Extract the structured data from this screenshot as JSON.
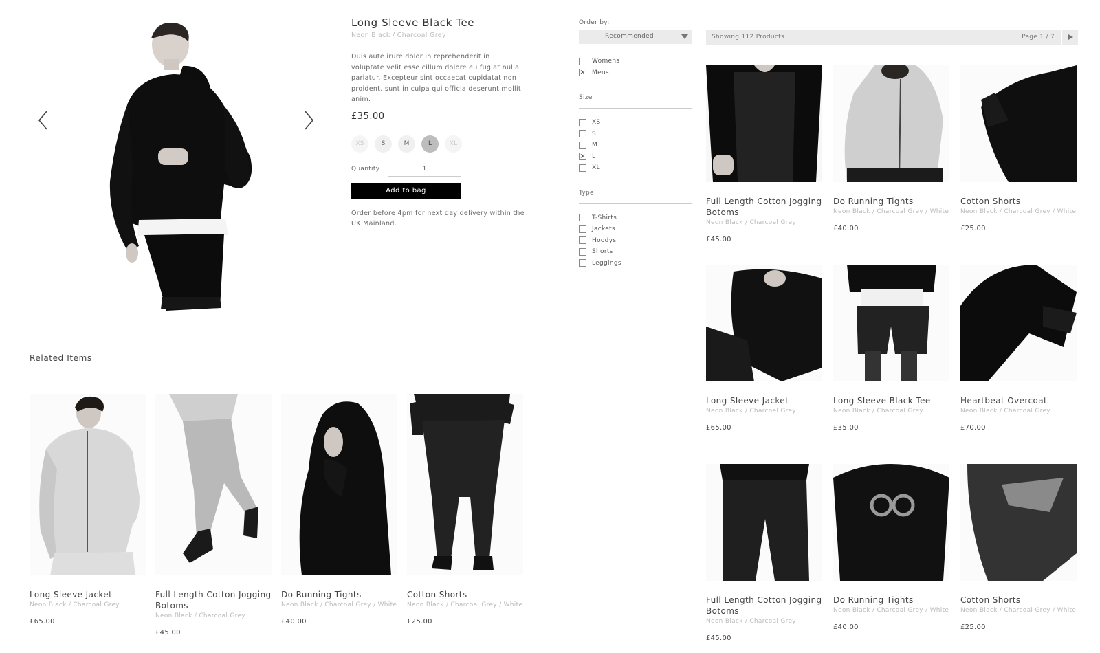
{
  "product": {
    "title": "Long Sleeve Black Tee",
    "variant": "Neon Black / Charcoal Grey",
    "description": "Duis aute irure dolor in reprehenderit in voluptate velit esse cillum dolore eu fugiat nulla pariatur. Excepteur sint occaecat cupidatat non proident, sunt in culpa qui officia deserunt mollit anim.",
    "price": "£35.00",
    "sizes": [
      "XS",
      "S",
      "M",
      "L",
      "XL"
    ],
    "selected_size": "L",
    "unavailable_sizes": [
      "XS",
      "XL"
    ],
    "quantity_label": "Quantity",
    "quantity_value": "1",
    "add_button": "Add to bag",
    "delivery_note": "Order before 4pm for next day delivery within the UK Mainland.",
    "icons": {
      "prev": "chevron-left-icon",
      "next": "chevron-right-icon"
    }
  },
  "related": {
    "title": "Related Items",
    "items": [
      {
        "name": "Long Sleeve Jacket",
        "variant": "Neon Black / Charcoal Grey",
        "price": "£65.00"
      },
      {
        "name": "Full Length Cotton Jogging Botoms",
        "variant": "Neon Black / Charcoal Grey",
        "price": "£45.00"
      },
      {
        "name": "Do Running Tights",
        "variant": "Neon Black / Charcoal Grey / White",
        "price": "£40.00"
      },
      {
        "name": "Cotton Shorts",
        "variant": "Neon Black / Charcoal Grey / White",
        "price": "£25.00"
      }
    ]
  },
  "filters": {
    "order_label": "Order by:",
    "order_value": "Recommended",
    "gender": [
      {
        "label": "Womens",
        "checked": false
      },
      {
        "label": "Mens",
        "checked": true
      }
    ],
    "size_heading": "Size",
    "sizes": [
      {
        "label": "XS",
        "checked": false
      },
      {
        "label": "S",
        "checked": false
      },
      {
        "label": "M",
        "checked": false
      },
      {
        "label": "L",
        "checked": true
      },
      {
        "label": "XL",
        "checked": false
      }
    ],
    "type_heading": "Type",
    "types": [
      {
        "label": "T-Shirts",
        "checked": false
      },
      {
        "label": "Jackets",
        "checked": false
      },
      {
        "label": "Hoodys",
        "checked": false
      },
      {
        "label": "Shorts",
        "checked": false
      },
      {
        "label": "Leggings",
        "checked": false
      }
    ]
  },
  "listing": {
    "count_text": "Showing 112 Products",
    "page_text": "Page 1 / 7",
    "items": [
      {
        "name": "Full Length Cotton Jogging Botoms",
        "variant": "Neon Black / Charcoal Grey",
        "price": "£45.00"
      },
      {
        "name": "Do Running Tights",
        "variant": "Neon Black / Charcoal Grey / White",
        "price": "£40.00"
      },
      {
        "name": "Cotton Shorts",
        "variant": "Neon Black / Charcoal Grey / White",
        "price": "£25.00"
      },
      {
        "name": "Long Sleeve Jacket",
        "variant": "Neon Black / Charcoal Grey",
        "price": "£65.00"
      },
      {
        "name": "Long Sleeve Black Tee",
        "variant": "Neon Black / Charcoal Grey",
        "price": "£35.00"
      },
      {
        "name": "Heartbeat Overcoat",
        "variant": "Neon Black / Charcoal Grey",
        "price": "£70.00"
      },
      {
        "name": "Full Length Cotton Jogging Botoms",
        "variant": "Neon Black / Charcoal Grey",
        "price": "£45.00"
      },
      {
        "name": "Do Running Tights",
        "variant": "Neon Black / Charcoal Grey / White",
        "price": "£40.00"
      },
      {
        "name": "Cotton Shorts",
        "variant": "Neon Black / Charcoal Grey / White",
        "price": "£25.00"
      }
    ]
  },
  "colors": {
    "accent": "#000000",
    "muted_text": "#bbbbbb",
    "bar_bg": "#ebebeb"
  }
}
